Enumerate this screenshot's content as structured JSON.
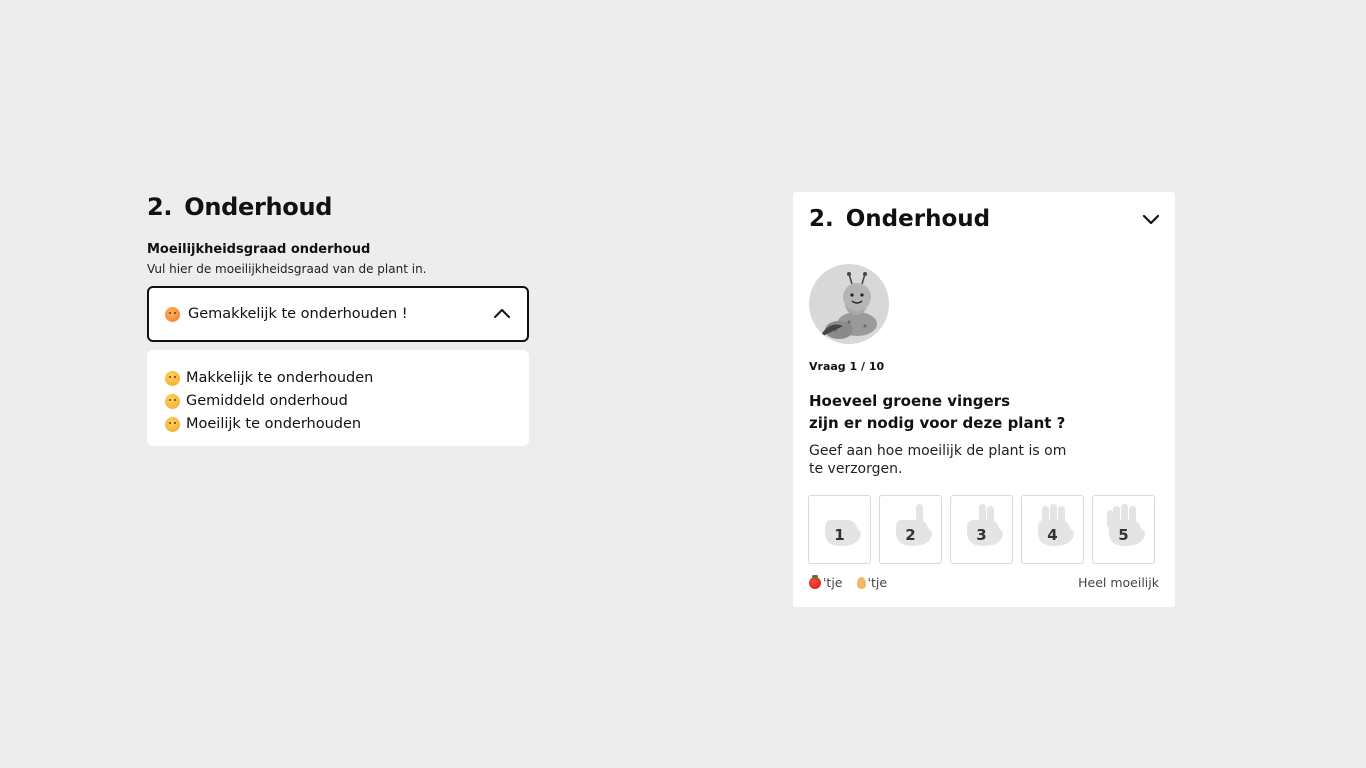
{
  "left": {
    "section_number": "2.",
    "section_title": "Onderhoud",
    "field_label": "Moeilijkheidsgraad onderhoud",
    "field_help": "Vul hier de moeilijkheidsgraad van de plant in.",
    "selected_value": "Gemakkelijk te onderhouden !",
    "selected_icon": "smiling-emoji-icon",
    "options": [
      {
        "label": "Makkelijk te onderhouden",
        "icon": "slightly-smiling-emoji-icon"
      },
      {
        "label": "Gemiddeld onderhoud",
        "icon": "neutral-emoji-icon"
      },
      {
        "label": "Moeilijk te onderhouden",
        "icon": "worried-emoji-icon"
      }
    ],
    "dropdown_open": true
  },
  "card": {
    "section_number": "2.",
    "section_title": "Onderhoud",
    "collapse_icon": "chevron-down-icon",
    "avatar": "caterpillar-mascot",
    "question_counter": "Vraag 1 / 10",
    "question_title_line1": "Hoeveel groene vingers",
    "question_title_line2": "zijn er nodig voor deze plant ?",
    "question_description": "Geef aan hoe moeilijk de plant is om te verzorgen.",
    "scale": [
      {
        "value": "1",
        "icon": "hand-icon"
      },
      {
        "value": "2",
        "icon": "hand-icon"
      },
      {
        "value": "3",
        "icon": "hand-icon"
      },
      {
        "value": "4",
        "icon": "hand-icon"
      },
      {
        "value": "5",
        "icon": "hand-icon"
      }
    ],
    "scale_min_suffix_1": "'tje",
    "scale_min_suffix_2": "'tje",
    "scale_min_icons": [
      "tomato-icon",
      "egg-icon"
    ],
    "scale_max_label": "Heel moeilijk"
  },
  "colors": {
    "background": "#ededed",
    "card": "#ffffff",
    "text": "#111111",
    "emoji": "#f3a52c"
  }
}
